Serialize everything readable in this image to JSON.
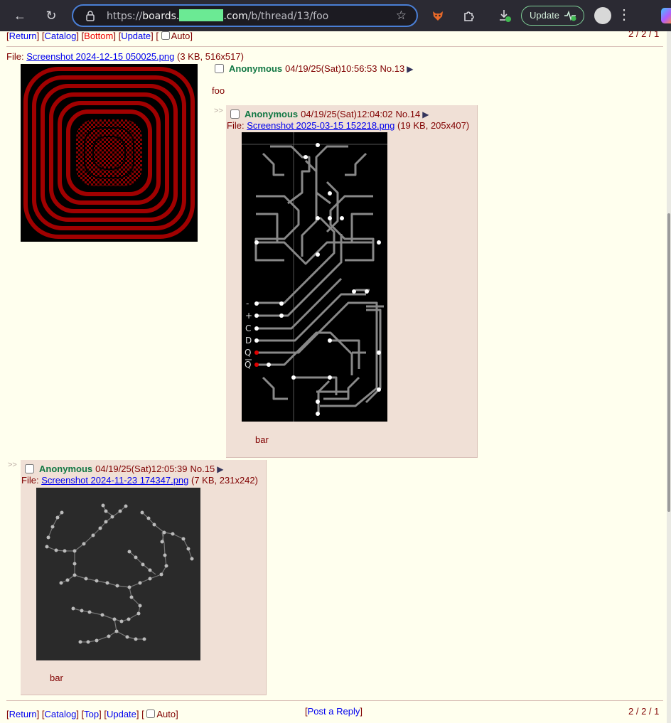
{
  "browser": {
    "url_prefix": "https://",
    "url_host_start": "boards.",
    "url_host_end": ".com",
    "url_path": "/b/thread/13/foo",
    "update_label": "Update"
  },
  "nav": {
    "return": "Return",
    "catalog": "Catalog",
    "bottom": "Bottom",
    "top": "Top",
    "update": "Update",
    "auto": "Auto",
    "post_reply": "Post a Reply",
    "page_count": "2 / 2 / 1"
  },
  "op": {
    "file_prefix": "File:",
    "file_name": "Screenshot 2024-12-15 050025.png",
    "file_meta": "(3 KB, 516x517)",
    "name": "Anonymous",
    "datetime": "04/19/25(Sat)10:56:53",
    "post_no": "No.13",
    "message": "foo"
  },
  "replies": [
    {
      "name": "Anonymous",
      "datetime": "04/19/25(Sat)12:04:02",
      "post_no": "No.14",
      "file_prefix": "File:",
      "file_name": "Screenshot 2025-03-15 152218.png",
      "file_meta": "(19 KB, 205x407)",
      "message": "bar",
      "circuit_labels": [
        "-",
        "+",
        "C",
        "D",
        "Q",
        "Q"
      ]
    },
    {
      "name": "Anonymous",
      "datetime": "04/19/25(Sat)12:05:39",
      "post_no": "No.15",
      "file_prefix": "File:",
      "file_name": "Screenshot 2024-11-23 174347.png",
      "file_meta": "(7 KB, 231x242)",
      "message": "bar"
    }
  ],
  "side_arrows": ">>",
  "colors": {
    "background": "#ffffee",
    "reply_background": "#f0e0d6",
    "name": "#117743",
    "text": "#800000",
    "link": "#0000ee"
  }
}
